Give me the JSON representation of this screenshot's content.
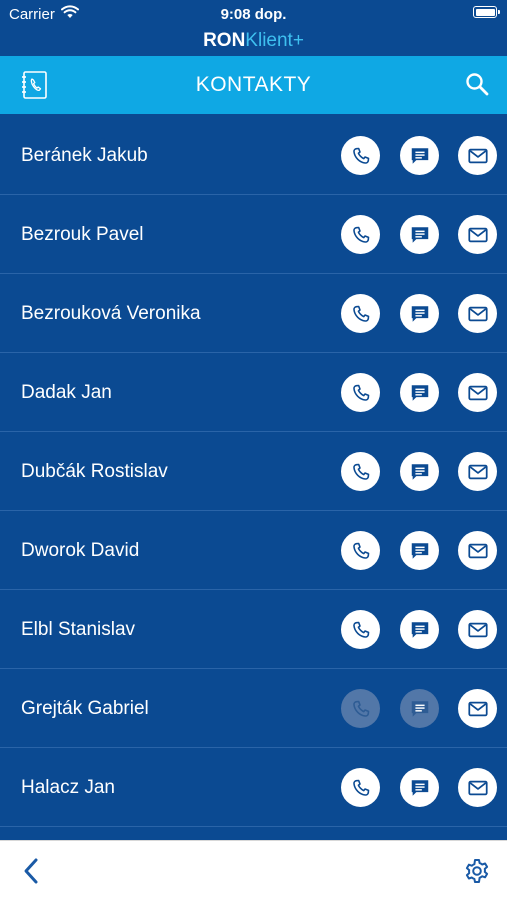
{
  "status": {
    "carrier": "Carrier",
    "time": "9:08 dop."
  },
  "brand": {
    "part1": "RON",
    "part2": "Klient+"
  },
  "header": {
    "title": "KONTAKTY"
  },
  "contacts": [
    {
      "name": "Beránek Jakub",
      "call_enabled": true,
      "sms_enabled": true,
      "mail_enabled": true
    },
    {
      "name": "Bezrouk Pavel",
      "call_enabled": true,
      "sms_enabled": true,
      "mail_enabled": true
    },
    {
      "name": "Bezrouková Veronika",
      "call_enabled": true,
      "sms_enabled": true,
      "mail_enabled": true
    },
    {
      "name": "Dadak Jan",
      "call_enabled": true,
      "sms_enabled": true,
      "mail_enabled": true
    },
    {
      "name": "Dubčák Rostislav",
      "call_enabled": true,
      "sms_enabled": true,
      "mail_enabled": true
    },
    {
      "name": "Dworok David",
      "call_enabled": true,
      "sms_enabled": true,
      "mail_enabled": true
    },
    {
      "name": "Elbl Stanislav",
      "call_enabled": true,
      "sms_enabled": true,
      "mail_enabled": true
    },
    {
      "name": "Grejták Gabriel",
      "call_enabled": false,
      "sms_enabled": false,
      "mail_enabled": true
    },
    {
      "name": "Halacz Jan",
      "call_enabled": true,
      "sms_enabled": true,
      "mail_enabled": true
    },
    {
      "name": "",
      "call_enabled": true,
      "sms_enabled": true,
      "mail_enabled": true
    }
  ],
  "icons": {
    "header_left": "address-book-icon",
    "header_right": "search-icon",
    "row_actions": [
      "phone-icon",
      "message-icon",
      "mail-icon"
    ],
    "bottom_left": "chevron-left-icon",
    "bottom_right": "gear-icon"
  },
  "colors": {
    "background": "#0b4a92",
    "header": "#0fa8e4",
    "brand_accent": "#3ec0f0",
    "icon_blue": "#0b4a92",
    "disabled_button": "#5277a8"
  }
}
